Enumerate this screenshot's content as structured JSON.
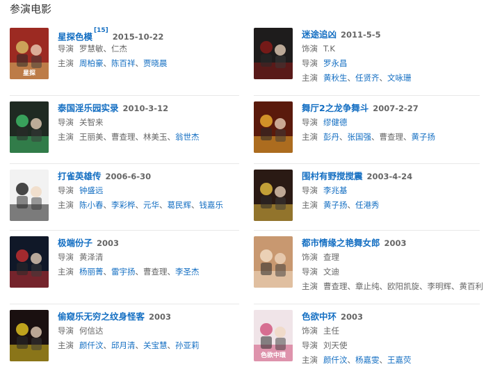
{
  "section_title": "参演电影",
  "labels": {
    "director": "导演",
    "actor": "饰演",
    "star": "主演"
  },
  "separator": "、",
  "colors": {
    "link": "#136ec2",
    "text": "#666666",
    "divider": "#e8e8e8"
  },
  "movies": [
    {
      "title": "星探色模",
      "cite": "[15]",
      "date": "2015-10-22",
      "rows": [
        {
          "label": "导演",
          "people": [
            {
              "name": "罗慧敏",
              "link": false
            },
            {
              "name": "仁杰",
              "link": false
            }
          ]
        },
        {
          "label": "主演",
          "people": [
            {
              "name": "周柏豪",
              "link": true
            },
            {
              "name": "陈百祥",
              "link": true
            },
            {
              "name": "贾晓晨",
              "link": true
            }
          ]
        }
      ],
      "poster": {
        "bg": "#9c2a22",
        "accent": "#d8c068",
        "caption": "星探"
      }
    },
    {
      "title": "迷途追凶",
      "cite": "",
      "date": "2011-5-5",
      "rows": [
        {
          "label": "饰演",
          "people": [
            {
              "name": "T.K",
              "link": false
            }
          ]
        },
        {
          "label": "导演",
          "people": [
            {
              "name": "罗永昌",
              "link": true
            }
          ]
        },
        {
          "label": "主演",
          "people": [
            {
              "name": "黄秋生",
              "link": true
            },
            {
              "name": "任贤齐",
              "link": true
            },
            {
              "name": "文咏珊",
              "link": true
            }
          ]
        }
      ],
      "poster": {
        "bg": "#1e1c1c",
        "accent": "#8a1a18",
        "caption": ""
      }
    },
    {
      "title": "泰国淫乐园实录",
      "cite": "",
      "date": "2010-3-12",
      "rows": [
        {
          "label": "导演",
          "people": [
            {
              "name": "关智来",
              "link": false
            }
          ]
        },
        {
          "label": "主演",
          "people": [
            {
              "name": "王丽美",
              "link": false
            },
            {
              "name": "曹查理",
              "link": false
            },
            {
              "name": "林美玉",
              "link": false
            },
            {
              "name": "翁世杰",
              "link": true
            }
          ]
        }
      ],
      "poster": {
        "bg": "#1f2a22",
        "accent": "#3fbf6a",
        "caption": ""
      }
    },
    {
      "title": "舞厅2之龙争舞斗",
      "cite": "",
      "date": "2007-2-27",
      "rows": [
        {
          "label": "导演",
          "people": [
            {
              "name": "缪健德",
              "link": true
            }
          ]
        },
        {
          "label": "主演",
          "people": [
            {
              "name": "彭丹",
              "link": true
            },
            {
              "name": "张国强",
              "link": true
            },
            {
              "name": "曹查理",
              "link": false
            },
            {
              "name": "黄子扬",
              "link": true
            }
          ]
        }
      ],
      "poster": {
        "bg": "#5a1a0c",
        "accent": "#f0b030",
        "caption": ""
      }
    },
    {
      "title": "打雀英雄传",
      "cite": "",
      "date": "2006-6-30",
      "rows": [
        {
          "label": "导演",
          "people": [
            {
              "name": "钟盛远",
              "link": true
            }
          ]
        },
        {
          "label": "主演",
          "people": [
            {
              "name": "陈小春",
              "link": true
            },
            {
              "name": "李彩桦",
              "link": true
            },
            {
              "name": "元华",
              "link": true
            },
            {
              "name": "葛民辉",
              "link": true
            },
            {
              "name": "钱嘉乐",
              "link": true
            }
          ]
        }
      ],
      "poster": {
        "bg": "#f2f2f2",
        "accent": "#1a1a1a",
        "caption": ""
      }
    },
    {
      "title": "围村有野搅搅震",
      "cite": "",
      "date": "2003-4-24",
      "rows": [
        {
          "label": "导演",
          "people": [
            {
              "name": "李兆基",
              "link": true
            }
          ]
        },
        {
          "label": "主演",
          "people": [
            {
              "name": "黄子扬",
              "link": true
            },
            {
              "name": "任港秀",
              "link": true
            }
          ]
        }
      ],
      "poster": {
        "bg": "#2a1a14",
        "accent": "#e8c040",
        "caption": ""
      }
    },
    {
      "title": "极端份子",
      "cite": "",
      "date": "2003",
      "rows": [
        {
          "label": "导演",
          "people": [
            {
              "name": "黄泽清",
              "link": false
            }
          ]
        },
        {
          "label": "主演",
          "people": [
            {
              "name": "杨丽菁",
              "link": true
            },
            {
              "name": "雷宇扬",
              "link": true
            },
            {
              "name": "曹查理",
              "link": false
            },
            {
              "name": "李圣杰",
              "link": true
            }
          ]
        }
      ],
      "poster": {
        "bg": "#101828",
        "accent": "#c83030",
        "caption": ""
      }
    },
    {
      "title": "都市情缘之艳舞女郎",
      "cite": "",
      "date": "2003",
      "rows": [
        {
          "label": "饰演",
          "people": [
            {
              "name": "查理",
              "link": false
            }
          ]
        },
        {
          "label": "导演",
          "people": [
            {
              "name": "文迪",
              "link": false
            }
          ]
        },
        {
          "label": "主演",
          "people": [
            {
              "name": "曹查理",
              "link": false
            },
            {
              "name": "章止纯",
              "link": false
            },
            {
              "name": "欧阳凯旋",
              "link": false
            },
            {
              "name": "李明辉",
              "link": false
            },
            {
              "name": "黄百利",
              "link": false
            }
          ]
        }
      ],
      "poster": {
        "bg": "#c89870",
        "accent": "#f4e0c8",
        "caption": ""
      }
    },
    {
      "title": "偷窥乐无穷之纹身怪客",
      "cite": "",
      "date": "2003",
      "rows": [
        {
          "label": "导演",
          "people": [
            {
              "name": "何信达",
              "link": false
            }
          ]
        },
        {
          "label": "主演",
          "people": [
            {
              "name": "颜仟汶",
              "link": true
            },
            {
              "name": "邱月清",
              "link": true
            },
            {
              "name": "关宝慧",
              "link": true
            },
            {
              "name": "孙亚莉",
              "link": true
            }
          ]
        }
      ],
      "poster": {
        "bg": "#1a1010",
        "accent": "#e8c820",
        "caption": ""
      }
    },
    {
      "title": "色欲中环",
      "cite": "",
      "date": "2003",
      "rows": [
        {
          "label": "饰演",
          "people": [
            {
              "name": "主任",
              "link": false
            }
          ]
        },
        {
          "label": "导演",
          "people": [
            {
              "name": "刘天使",
              "link": false
            }
          ]
        },
        {
          "label": "主演",
          "people": [
            {
              "name": "颜仟汶",
              "link": true
            },
            {
              "name": "杨嘉雯",
              "link": true
            },
            {
              "name": "王嘉荧",
              "link": true
            }
          ]
        }
      ],
      "poster": {
        "bg": "#f0e4e8",
        "accent": "#d0507a",
        "caption": "色欲中環"
      }
    }
  ]
}
